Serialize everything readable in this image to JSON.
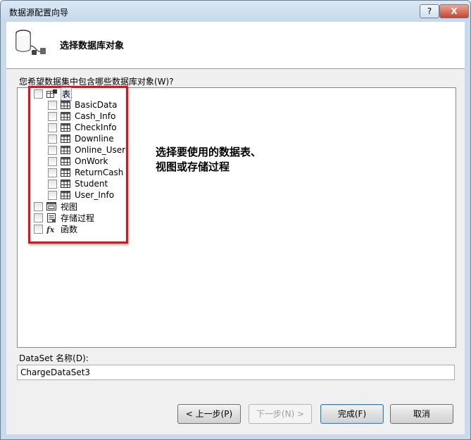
{
  "window": {
    "title": "数据源配置向导",
    "help_label": "?",
    "close_label": "X"
  },
  "header": {
    "title": "选择数据库对象"
  },
  "question": "您希望数据集中包含哪些数据库对象(W)?",
  "tree": {
    "tables_label": "表",
    "tables": [
      "BasicData",
      "Cash_Info",
      "CheckInfo",
      "Downline",
      "Online_User",
      "OnWork",
      "ReturnCash",
      "Student",
      "User_Info"
    ],
    "views_label": "视图",
    "procs_label": "存储过程",
    "funcs_label": "函数"
  },
  "annotation": {
    "line1": "选择要使用的数据表、",
    "line2": "视图或存储过程"
  },
  "dataset": {
    "label": "DataSet 名称(D):",
    "value": "ChargeDataSet3"
  },
  "buttons": {
    "prev": "< 上一步(P)",
    "next": "下一步(N) >",
    "finish": "完成(F)",
    "cancel": "取消"
  },
  "colors": {
    "annotation_border": "#d8141e",
    "default_button_border": "#3c7fb1"
  }
}
